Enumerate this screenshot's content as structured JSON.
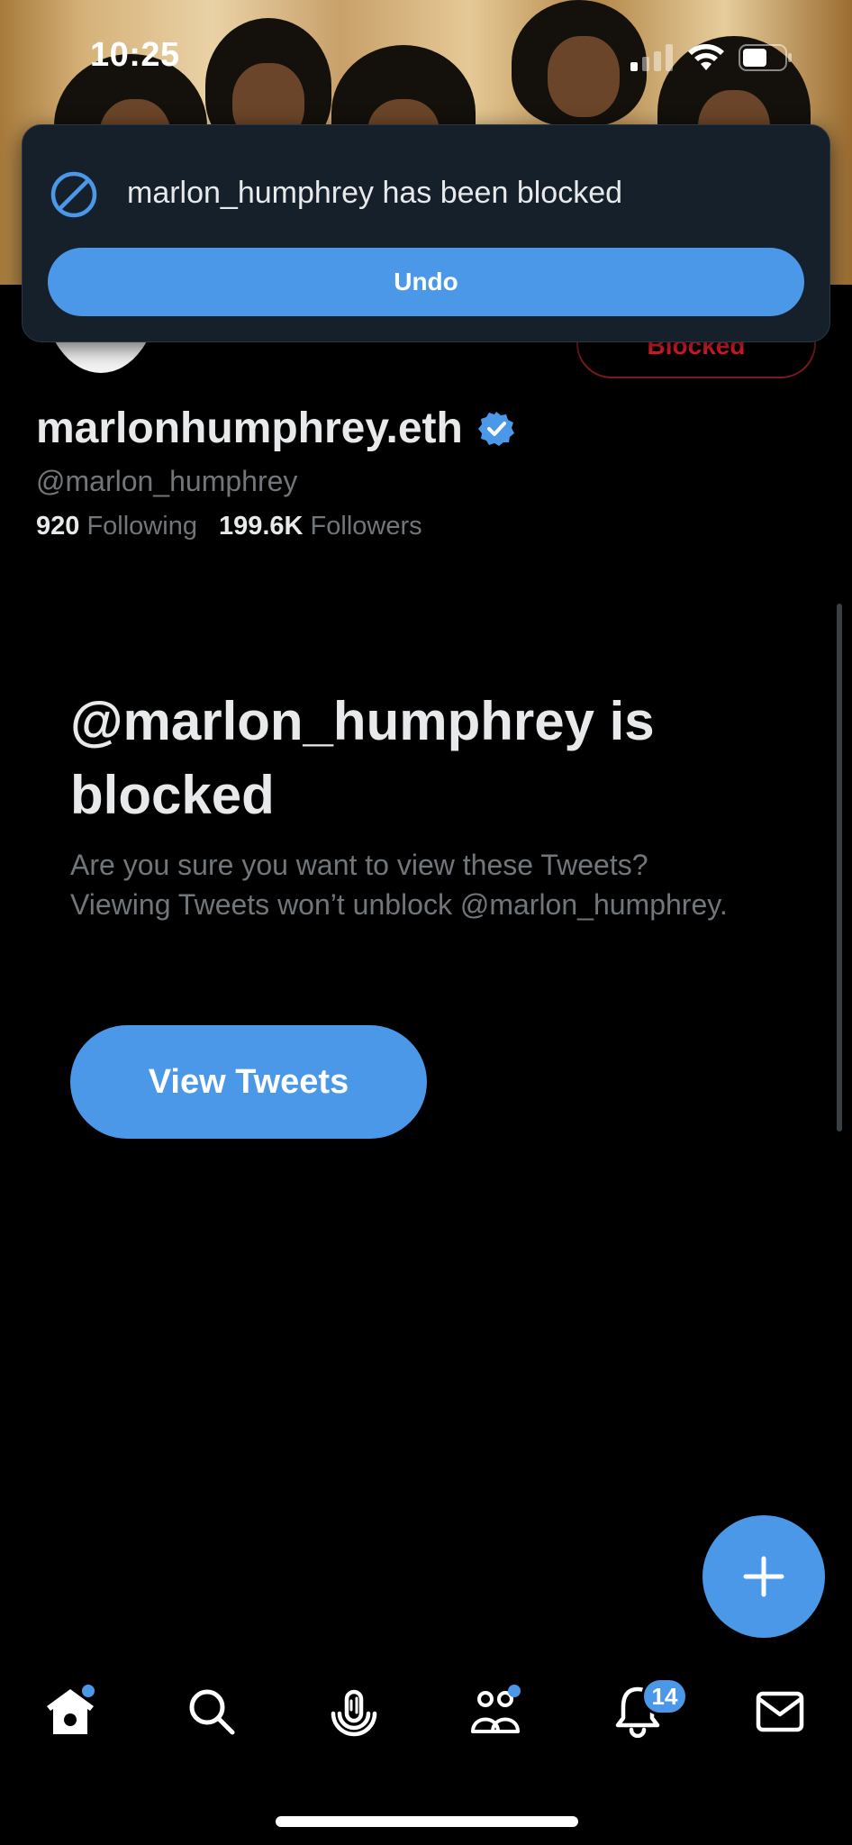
{
  "status_bar": {
    "time": "10:25"
  },
  "toast": {
    "message": "marlon_humphrey has been blocked",
    "undo_label": "Undo"
  },
  "profile": {
    "blocked_button_label": "Blocked",
    "display_name": "marlonhumphrey.eth",
    "handle": "@marlon_humphrey",
    "following_count": "920",
    "following_label": "Following",
    "followers_count": "199.6K",
    "followers_label": "Followers"
  },
  "blocked_notice": {
    "title": "@marlon_humphrey is blocked",
    "description": "Are you sure you want to view these Tweets? Viewing Tweets won’t unblock @marlon_humphrey.",
    "view_tweets_label": "View Tweets"
  },
  "tab_bar": {
    "items": [
      {
        "icon": "home-icon",
        "has_dot": true
      },
      {
        "icon": "search-icon"
      },
      {
        "icon": "spaces-icon"
      },
      {
        "icon": "communities-icon",
        "has_dot": true
      },
      {
        "icon": "notifications-icon"
      },
      {
        "icon": "messages-icon"
      }
    ],
    "notifications_badge": "14"
  },
  "colors": {
    "accent": "#4b98e8",
    "blocked_red": "#f4212e",
    "background": "#000000",
    "toast_bg": "#15202b"
  }
}
